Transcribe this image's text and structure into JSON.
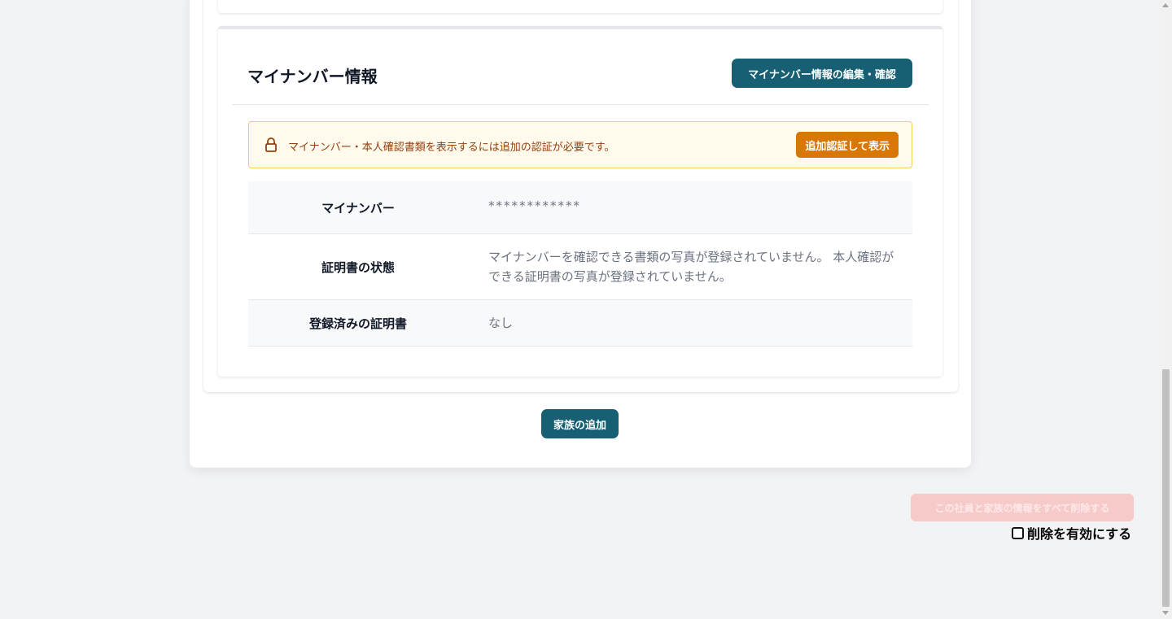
{
  "mynumber_section": {
    "title": "マイナンバー情報",
    "edit_button": "マイナンバー情報の編集・確認",
    "alert": {
      "message": "マイナンバー・本人確認書類を表示するには追加の認証が必要です。",
      "button": "追加認証して表示"
    },
    "rows": [
      {
        "label": "マイナンバー",
        "value": "************"
      },
      {
        "label": "証明書の状態",
        "value": "マイナンバーを確認できる書類の写真が登録されていません。 本人確認ができる証明書の写真が登録されていません。"
      },
      {
        "label": "登録済みの証明書",
        "value": "なし"
      }
    ]
  },
  "add_family_button": "家族の追加",
  "danger": {
    "delete_button": "この社員と家族の情報をすべて削除する",
    "enable_checkbox_label": "削除を有効にする",
    "enable_checked": false
  }
}
